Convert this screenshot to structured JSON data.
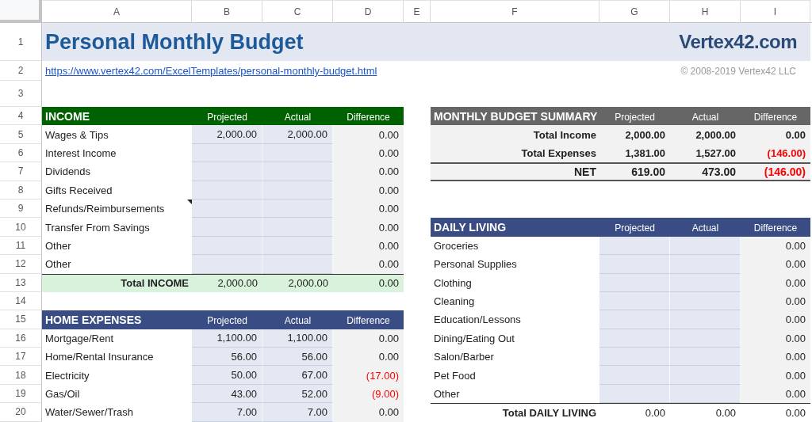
{
  "column_headers": [
    "A",
    "B",
    "C",
    "D",
    "E",
    "F",
    "G",
    "H",
    "I"
  ],
  "row_numbers": [
    "1",
    "2",
    "3",
    "4",
    "5",
    "6",
    "7",
    "8",
    "9",
    "10",
    "11",
    "12",
    "13",
    "14",
    "15",
    "16",
    "17",
    "18",
    "19",
    "20"
  ],
  "title": "Personal Monthly Budget",
  "logo": "Vertex42.com",
  "url": "https://www.vertex42.com/ExcelTemplates/personal-monthly-budget.html",
  "copyright": "© 2008-2019 Vertex42 LLC",
  "left_sections": [
    {
      "title": "INCOME",
      "kind": "category",
      "color": "#006100",
      "columns": [
        "Projected",
        "Actual",
        "Difference"
      ],
      "rows": [
        {
          "label": "Wages & Tips",
          "projected": "2,000.00",
          "actual": "2,000.00",
          "difference": "0.00",
          "negative": false,
          "has_note": false
        },
        {
          "label": "Interest Income",
          "difference": "0.00",
          "negative": false,
          "has_note": false
        },
        {
          "label": "Dividends",
          "difference": "0.00",
          "negative": false,
          "has_note": false
        },
        {
          "label": "Gifts Received",
          "difference": "0.00",
          "negative": false,
          "has_note": false
        },
        {
          "label": "Refunds/Reimbursements",
          "difference": "0.00",
          "negative": false,
          "has_note": true
        },
        {
          "label": "Transfer From Savings",
          "difference": "0.00",
          "negative": false,
          "has_note": false
        },
        {
          "label": "Other",
          "difference": "0.00",
          "negative": false,
          "has_note": false
        },
        {
          "label": "Other",
          "difference": "0.00",
          "negative": false,
          "has_note": false
        }
      ],
      "total": {
        "label": "Total INCOME",
        "projected": "2,000.00",
        "actual": "2,000.00",
        "difference": "0.00",
        "negative": false,
        "color": "#d9f2dc"
      }
    },
    {
      "title": "HOME EXPENSES",
      "kind": "category",
      "color": "#3a4c84",
      "columns": [
        "Projected",
        "Actual",
        "Difference"
      ],
      "rows": [
        {
          "label": "Mortgage/Rent",
          "projected": "1,100.00",
          "actual": "1,100.00",
          "difference": "0.00",
          "negative": false,
          "has_note": false
        },
        {
          "label": "Home/Rental Insurance",
          "projected": "56.00",
          "actual": "56.00",
          "difference": "0.00",
          "negative": false,
          "has_note": false
        },
        {
          "label": "Electricity",
          "projected": "50.00",
          "actual": "67.00",
          "difference": "(17.00)",
          "negative": true,
          "has_note": false
        },
        {
          "label": "Gas/Oil",
          "projected": "43.00",
          "actual": "52.00",
          "difference": "(9.00)",
          "negative": true,
          "has_note": false
        },
        {
          "label": "Water/Sewer/Trash",
          "projected": "7.00",
          "actual": "7.00",
          "difference": "0.00",
          "negative": false,
          "has_note": false
        }
      ]
    }
  ],
  "right_sections": [
    {
      "title": "MONTHLY BUDGET SUMMARY",
      "kind": "summary",
      "color": "#666666",
      "columns": [
        "Projected",
        "Actual",
        "Difference"
      ],
      "rows": [
        {
          "label": "Total Income",
          "projected": "2,000.00",
          "actual": "2,000.00",
          "difference": "0.00",
          "negative": false,
          "has_note": false
        },
        {
          "label": "Total Expenses",
          "projected": "1,381.00",
          "actual": "1,527.00",
          "difference": "(146.00)",
          "negative": true,
          "has_note": false
        }
      ],
      "total": {
        "label": "NET",
        "projected": "619.00",
        "actual": "473.00",
        "difference": "(146.00)",
        "negative": true,
        "color": "#f2f2f2"
      }
    },
    {
      "title": "DAILY LIVING",
      "kind": "category",
      "color": "#3a4c84",
      "columns": [
        "Projected",
        "Actual",
        "Difference"
      ],
      "rows": [
        {
          "label": "Groceries",
          "difference": "0.00",
          "negative": false,
          "has_note": false
        },
        {
          "label": "Personal Supplies",
          "difference": "0.00",
          "negative": false,
          "has_note": false
        },
        {
          "label": "Clothing",
          "difference": "0.00",
          "negative": false,
          "has_note": false
        },
        {
          "label": "Cleaning",
          "difference": "0.00",
          "negative": false,
          "has_note": false
        },
        {
          "label": "Education/Lessons",
          "difference": "0.00",
          "negative": false,
          "has_note": false
        },
        {
          "label": "Dining/Eating Out",
          "difference": "0.00",
          "negative": false,
          "has_note": false
        },
        {
          "label": "Salon/Barber",
          "difference": "0.00",
          "negative": false,
          "has_note": false
        },
        {
          "label": "Pet Food",
          "difference": "0.00",
          "negative": false,
          "has_note": false
        },
        {
          "label": "Other",
          "difference": "0.00",
          "negative": false,
          "has_note": false
        }
      ],
      "total": {
        "label": "Total DAILY LIVING",
        "projected": "0.00",
        "actual": "0.00",
        "difference": "0.00",
        "negative": false,
        "color": "#ffffff"
      }
    }
  ]
}
